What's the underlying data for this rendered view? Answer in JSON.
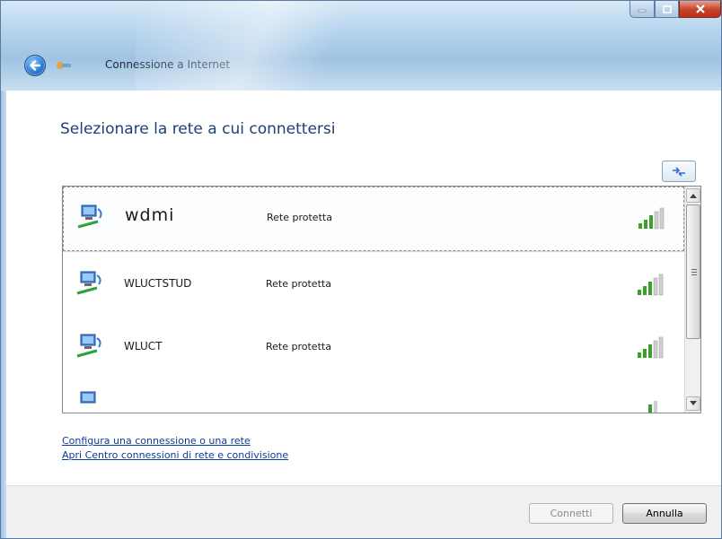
{
  "window": {
    "title": "Connessione a Internet",
    "controls": {
      "minimize_icon": "minimize-icon",
      "maximize_icon": "maximize-icon",
      "close_icon": "close-icon"
    }
  },
  "main": {
    "heading": "Selezionare la rete a cui connettersi",
    "refresh_icon": "refresh-icon"
  },
  "networks": [
    {
      "name": "wdmi",
      "status": "Rete protetta",
      "selected": true,
      "signal": "strong"
    },
    {
      "name": "WLUCTSTUD",
      "status": "Rete protetta",
      "selected": false,
      "signal": "strong"
    },
    {
      "name": "WLUCT",
      "status": "Rete protetta",
      "selected": false,
      "signal": "strong"
    },
    {
      "name": "",
      "status": "",
      "selected": false,
      "signal": "weak"
    }
  ],
  "links": {
    "setup_connection": "Configura una connessione o una rete",
    "network_center": "Apri Centro connessioni di rete e condivisione"
  },
  "buttons": {
    "connect": "Connetti",
    "cancel": "Annulla"
  },
  "colors": {
    "heading": "#1f3f74",
    "link": "#0b3c9d",
    "signal_green": "#3aa02a"
  }
}
